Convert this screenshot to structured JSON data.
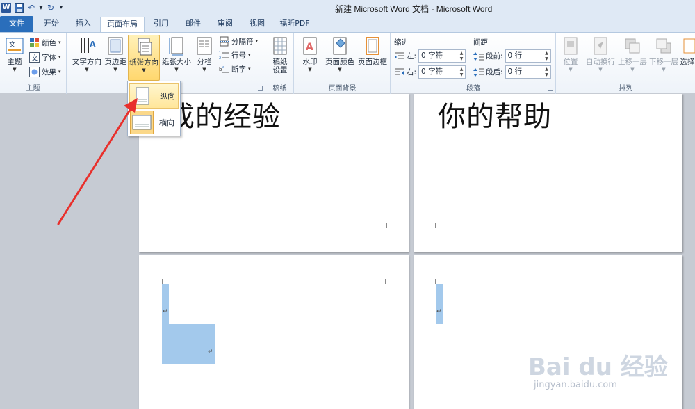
{
  "window": {
    "title": "新建 Microsoft Word 文档 - Microsoft Word"
  },
  "tabs": [
    {
      "label": "文件"
    },
    {
      "label": "开始"
    },
    {
      "label": "插入"
    },
    {
      "label": "页面布局"
    },
    {
      "label": "引用"
    },
    {
      "label": "邮件"
    },
    {
      "label": "审阅"
    },
    {
      "label": "视图"
    },
    {
      "label": "福昕PDF"
    }
  ],
  "active_tab": "页面布局",
  "ribbon": {
    "theme": {
      "label": "主题",
      "colors": "颜色",
      "fonts": "字体",
      "effects": "效果",
      "group": "主题"
    },
    "page_setup": {
      "text_direction": "文字方向",
      "margins": "页边距",
      "orientation": "纸张方向",
      "size": "纸张大小",
      "columns": "分栏",
      "breaks": "分隔符",
      "line_numbers": "行号",
      "hyphenation": "断字"
    },
    "manuscript": {
      "label1": "稿纸",
      "label2": "设置",
      "group": "稿纸"
    },
    "page_background": {
      "watermark": "水印",
      "page_color": "页面颜色",
      "page_borders": "页面边框",
      "group": "页面背景"
    },
    "paragraph": {
      "indent_title": "缩进",
      "spacing_title": "间距",
      "left_label": "左:",
      "left_value": "0 字符",
      "right_label": "右:",
      "right_value": "0 字符",
      "before_label": "段前:",
      "before_value": "0 行",
      "after_label": "段后:",
      "after_value": "0 行",
      "group": "段落"
    },
    "arrange": {
      "position": "位置",
      "wrap": "自动换行",
      "bring_forward": "上移一层",
      "send_backward": "下移一层",
      "select": "选择",
      "group": "排列"
    }
  },
  "orientation_menu": {
    "portrait": "纵向",
    "landscape": "横向"
  },
  "document": {
    "page1_text": "成的经验",
    "page2_text": "你的帮助",
    "para_mark": "↵"
  },
  "watermark": {
    "brand": "Bai du 经验",
    "url": "jingyan.baidu.com"
  },
  "colors": {
    "accent": "#2a6ebb",
    "highlight": "#ffd76e",
    "arrow": "#e8302c",
    "selection": "#a3c9ec"
  }
}
